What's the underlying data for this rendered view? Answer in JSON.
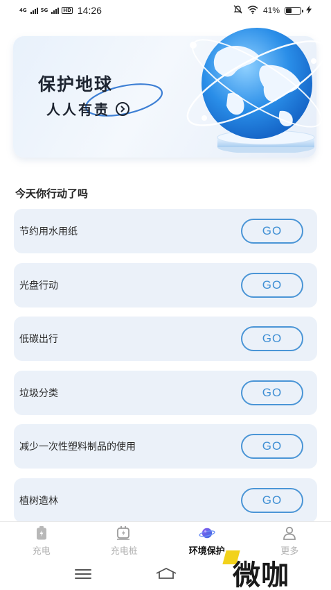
{
  "status_bar": {
    "net1": "4G",
    "net2": "5G",
    "hd": "HD",
    "time": "14:26",
    "battery": "41%",
    "battery_level": 0.41
  },
  "banner": {
    "title": "保护地球",
    "subtitle": "人人有责",
    "arrow": "›"
  },
  "section": {
    "title": "今天你行动了吗"
  },
  "actions": [
    {
      "label": "节约用水用纸",
      "button": "GO"
    },
    {
      "label": "光盘行动",
      "button": "GO"
    },
    {
      "label": "低碳出行",
      "button": "GO"
    },
    {
      "label": "垃圾分类",
      "button": "GO"
    },
    {
      "label": "减少一次性塑料制品的使用",
      "button": "GO"
    },
    {
      "label": "植树造林",
      "button": "GO"
    }
  ],
  "bottom_nav": [
    {
      "label": "充电",
      "icon": "battery-icon",
      "active": false
    },
    {
      "label": "充电桩",
      "icon": "charging-pile-icon",
      "active": false
    },
    {
      "label": "环境保护",
      "icon": "planet-icon",
      "active": true
    },
    {
      "label": "更多",
      "icon": "person-icon",
      "active": false
    }
  ],
  "watermark": "微咖",
  "colors": {
    "accent": "#4a95d6",
    "card_bg": "#ebf1f9",
    "inactive_nav": "#b0b0b0"
  }
}
